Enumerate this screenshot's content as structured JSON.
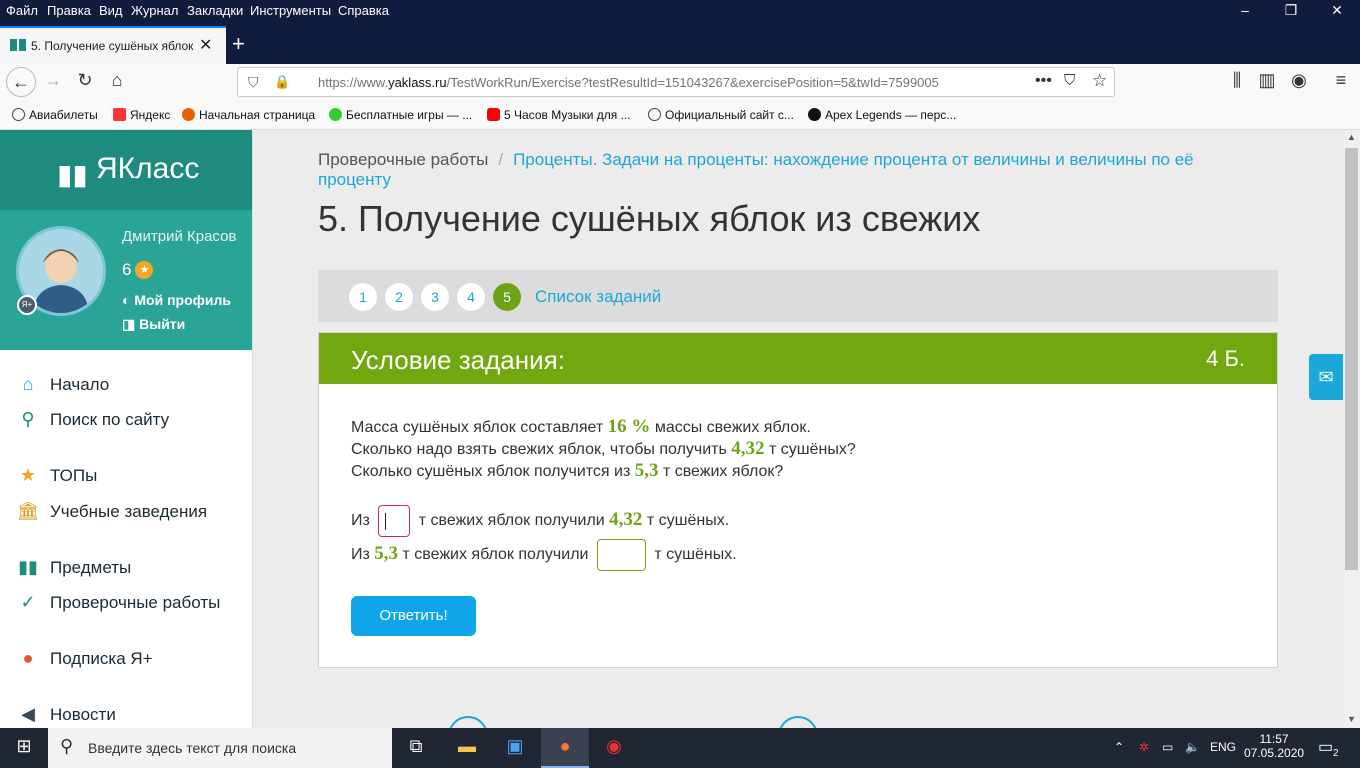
{
  "browser": {
    "menu": [
      "Файл",
      "Правка",
      "Вид",
      "Журнал",
      "Закладки",
      "Инструменты",
      "Справка"
    ],
    "tab_title": "5. Получение сушёных яблок из свежих",
    "url_prefix": "https://www.",
    "url_domain": "yaklass.ru",
    "url_rest": "/TestWorkRun/Exercise?testResultId=151043267&exercisePosition=5&twId=7599005",
    "bookmarks": [
      "Авиабилеты",
      "Яндекс",
      "Начальная страница",
      "Бесплатные игры — ...",
      "5 Часов Музыки для ...",
      "Официальный сайт с...",
      "Apex Legends — перс..."
    ]
  },
  "sidebar": {
    "logo": "ЯКласс",
    "user_name": "Дмитрий Красов",
    "score": "6",
    "profile": "Мой профиль",
    "logout": "Выйти",
    "nav": [
      "Начало",
      "Поиск по сайту",
      "ТОПы",
      "Учебные заведения",
      "Предметы",
      "Проверочные работы",
      "Подписка Я+",
      "Новости"
    ]
  },
  "page": {
    "crumb1": "Проверочные работы",
    "crumb2": "Проценты. Задачи на проценты: нахождение процента от величины и величины по её проценту",
    "title": "5. Получение сушёных яблок из свежих",
    "steps": [
      "1",
      "2",
      "3",
      "4",
      "5"
    ],
    "steps_link": "Список заданий",
    "task_header": "Условие задания:",
    "points": "4 Б.",
    "l1a": "Масса сушёных яблок составляет ",
    "l1v": "16 %",
    "l1b": " массы свежих яблок.",
    "l2a": "Сколько надо взять свежих яблок, чтобы получить ",
    "l2v": "4,32",
    "l2b": " т сушёных?",
    "l3a": "Сколько сушёных яблок получится из ",
    "l3v": "5,3",
    "l3b": " т свежих яблок?",
    "a1a": "Из",
    "a1b": "т свежих яблок получили",
    "a1v": "4,32",
    "a1c": "т сушёных.",
    "a2a": "Из",
    "a2v": "5,3",
    "a2b": "т свежих яблок получили",
    "a2c": "т сушёных.",
    "submit": "Ответить!"
  },
  "taskbar": {
    "search_placeholder": "Введите здесь текст для поиска",
    "lang": "ENG",
    "time": "11:57",
    "date": "07.05.2020",
    "notifications": "2"
  },
  "colors": {
    "accent": "#72a80f",
    "link": "#1ba7d7",
    "brand": "#1f8b7e"
  }
}
